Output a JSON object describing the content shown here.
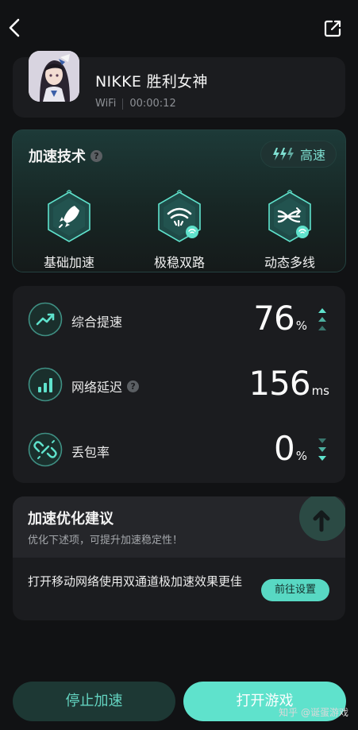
{
  "icons": {
    "back": "chevron-left-icon",
    "share": "share-icon"
  },
  "game": {
    "title": "NIKKE 胜利女神",
    "network": "WiFi",
    "elapsed": "00:00:12"
  },
  "tech": {
    "title": "加速技术",
    "help": "?",
    "speed_mode": "高速",
    "features": [
      {
        "label": "基础加速",
        "icon": "rocket-icon"
      },
      {
        "label": "极稳双路",
        "icon": "wifi-dual-icon"
      },
      {
        "label": "动态多线",
        "icon": "multiline-icon"
      }
    ]
  },
  "stats": {
    "boost": {
      "label": "综合提速",
      "value": "76",
      "unit": "%",
      "trend": "up"
    },
    "latency": {
      "label": "网络延迟",
      "value": "156",
      "unit": "ms"
    },
    "loss": {
      "label": "丢包率",
      "value": "0",
      "unit": "%",
      "trend": "down"
    }
  },
  "advice": {
    "title": "加速优化建议",
    "subtitle": "优化下述项，可提升加速稳定性！",
    "item_text": "打开移动网络使用双通道极加速效果更佳",
    "item_button": "前往设置"
  },
  "footer": {
    "stop_label": "停止加速",
    "open_label": "打开游戏",
    "watermark": "知乎 @诞蛋游戏"
  },
  "colors": {
    "accent": "#5fe2cc",
    "background": "#111214",
    "card": "#1b1c1f"
  }
}
